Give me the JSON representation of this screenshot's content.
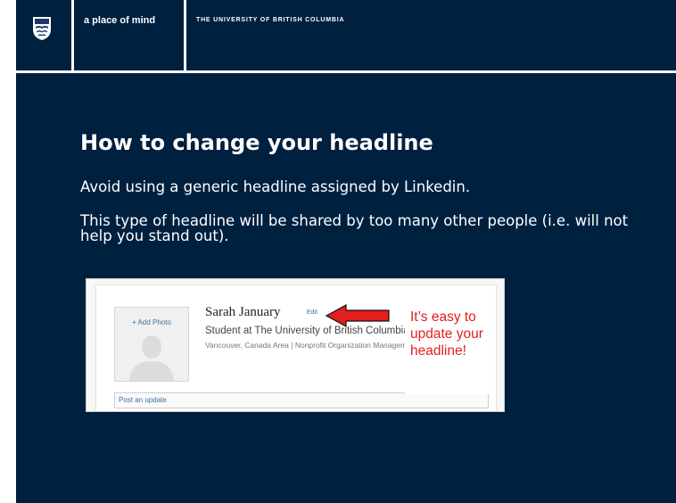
{
  "header": {
    "logo_text": "UBC",
    "tagline": "a place of mind",
    "university": "THE UNIVERSITY OF BRITISH COLUMBIA"
  },
  "slide": {
    "title": "How to change your headline",
    "paragraph1": "Avoid using a generic headline assigned by Linkedin.",
    "paragraph2": "This type of headline will be shared by too many other people (i.e. will not help you stand out)."
  },
  "profile": {
    "add_photo": "+ Add Photo",
    "name": "Sarah January",
    "edit": "Edit",
    "headline": "Student at The University of British Columbia",
    "location": "Vancouver, Canada Area",
    "industry": "Nonprofit Organization Management",
    "post_update": "Post an update"
  },
  "callout": {
    "text": "It’s easy to update your headline!",
    "color": "#e41e1e"
  },
  "colors": {
    "background": "#00203f",
    "text": "#ffffff"
  }
}
